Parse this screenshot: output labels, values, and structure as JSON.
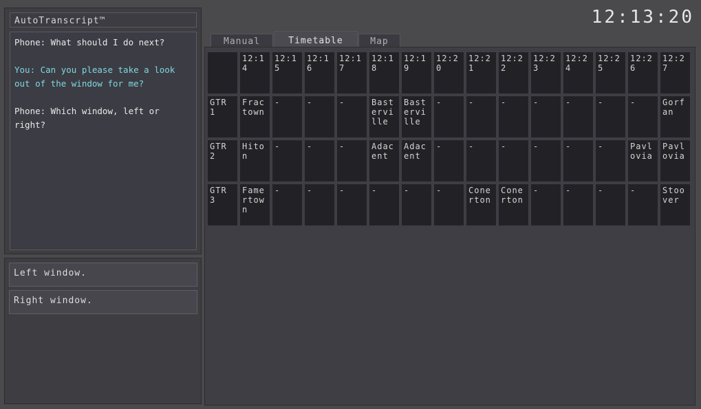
{
  "app": {
    "title": "AutoTranscript™",
    "clock": "12:13:20"
  },
  "transcript": [
    {
      "speaker": "phone",
      "text": "Phone: What should I do next?"
    },
    {
      "speaker": "you",
      "text": "You: Can you please take a look out of the window for me?"
    },
    {
      "speaker": "phone",
      "text": "Phone: Which window, left or right?"
    }
  ],
  "responses": [
    "Left window.",
    "Right window."
  ],
  "tabs": [
    {
      "label": "Manual",
      "active": false
    },
    {
      "label": "Timetable",
      "active": true
    },
    {
      "label": "Map",
      "active": false
    }
  ],
  "timetable": {
    "times": [
      "12:14",
      "12:15",
      "12:16",
      "12:17",
      "12:18",
      "12:19",
      "12:20",
      "12:21",
      "12:22",
      "12:23",
      "12:24",
      "12:25",
      "12:26",
      "12:27"
    ],
    "rows": [
      {
        "label": "GTR 1",
        "cells": [
          "Fractown",
          "-",
          "-",
          "-",
          "Basterville",
          "Basterville",
          "-",
          "-",
          "-",
          "-",
          "-",
          "-",
          "-",
          "Gorfan"
        ]
      },
      {
        "label": "GTR 2",
        "cells": [
          "Hiton",
          "-",
          "-",
          "-",
          "Adacent",
          "Adacent",
          "-",
          "-",
          "-",
          "-",
          "-",
          "-",
          "Pavlovia",
          "Pavlovia"
        ]
      },
      {
        "label": "GTR 3",
        "cells": [
          "Famertown",
          "-",
          "-",
          "-",
          "-",
          "-",
          "-",
          "Conerton",
          "Conerton",
          "-",
          "-",
          "-",
          "-",
          "Stoover"
        ]
      }
    ]
  },
  "colors": {
    "background": "#4a4a4c",
    "panel": "#3e3e44",
    "cell": "#222226",
    "you_text": "#7fd8e0",
    "phone_text": "#eaeaea"
  }
}
